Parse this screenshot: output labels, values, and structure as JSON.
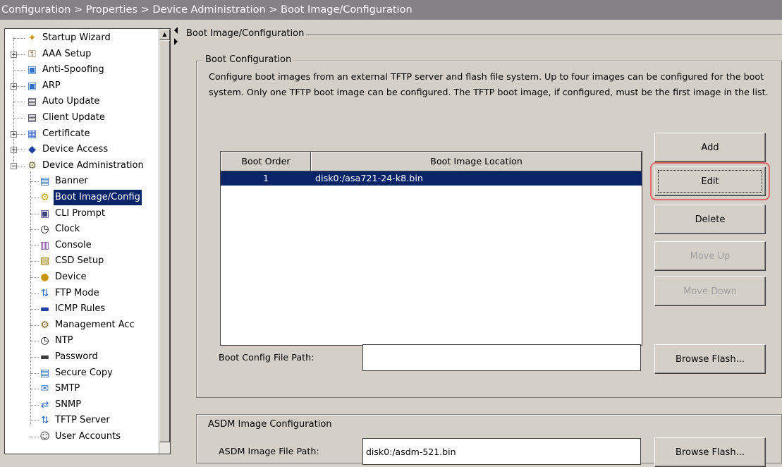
{
  "breadcrumb": "Configuration > Properties > Device Administration > Boot Image/Configuration",
  "tree": [
    {
      "label": "Startup Wizard",
      "icon": "wand-icon",
      "expandable": false,
      "level": 0
    },
    {
      "label": "AAA Setup",
      "icon": "key-icon",
      "expandable": true,
      "level": 0
    },
    {
      "label": "Anti-Spoofing",
      "icon": "shield-window-icon",
      "expandable": false,
      "level": 0
    },
    {
      "label": "ARP",
      "icon": "network-window-icon",
      "expandable": true,
      "level": 0
    },
    {
      "label": "Auto Update",
      "icon": "computer-icon",
      "expandable": false,
      "level": 0
    },
    {
      "label": "Client Update",
      "icon": "computer-icon",
      "expandable": false,
      "level": 0
    },
    {
      "label": "Certificate",
      "icon": "certificate-icon",
      "expandable": true,
      "level": 0
    },
    {
      "label": "Device Access",
      "icon": "device-access-icon",
      "expandable": true,
      "level": 0
    },
    {
      "label": "Device Administration",
      "icon": "admin-icon",
      "expandable": true,
      "expanded": true,
      "level": 0
    },
    {
      "label": "Banner",
      "icon": "banner-icon",
      "level": 1
    },
    {
      "label": "Boot Image/Config",
      "icon": "boot-image-icon",
      "level": 1,
      "selected": true
    },
    {
      "label": "CLI Prompt",
      "icon": "cli-prompt-icon",
      "level": 1
    },
    {
      "label": "Clock",
      "icon": "clock-icon",
      "level": 1
    },
    {
      "label": "Console",
      "icon": "console-icon",
      "level": 1
    },
    {
      "label": "CSD Setup",
      "icon": "csd-setup-icon",
      "level": 1
    },
    {
      "label": "Device",
      "icon": "device-icon",
      "level": 1
    },
    {
      "label": "FTP Mode",
      "icon": "ftp-icon",
      "level": 1
    },
    {
      "label": "ICMP Rules",
      "icon": "icmp-icon",
      "level": 1
    },
    {
      "label": "Management Acc",
      "icon": "management-icon",
      "level": 1
    },
    {
      "label": "NTP",
      "icon": "ntp-clock-icon",
      "level": 1
    },
    {
      "label": "Password",
      "icon": "password-icon",
      "level": 1
    },
    {
      "label": "Secure Copy",
      "icon": "secure-copy-icon",
      "level": 1
    },
    {
      "label": "SMTP",
      "icon": "smtp-icon",
      "level": 1
    },
    {
      "label": "SNMP",
      "icon": "snmp-icon",
      "level": 1
    },
    {
      "label": "TFTP Server",
      "icon": "tftp-icon",
      "level": 1
    },
    {
      "label": "User Accounts",
      "icon": "user-accounts-icon",
      "level": 1
    }
  ],
  "main": {
    "heading": "Boot Image/Configuration",
    "boot_config": {
      "legend": "Boot Configuration",
      "description": "Configure boot images from an external TFTP server and flash file system. Up to four images can be configured for the boot system. Only one TFTP boot image can be configured. The TFTP boot image, if configured, must be the first image in the list.",
      "columns": [
        "Boot Order",
        "Boot Image Location"
      ],
      "rows": [
        {
          "order": "1",
          "location": "disk0:/asa721-24-k8.bin",
          "selected": true
        }
      ],
      "buttons": {
        "add": "Add",
        "edit": "Edit",
        "delete": "Delete",
        "move_up": "Move Up",
        "move_down": "Move Down"
      },
      "config_path_label": "Boot Config File Path:",
      "config_path_value": "",
      "browse_flash": "Browse Flash..."
    },
    "asdm": {
      "legend": "ASDM Image Configuration",
      "path_label": "ASDM Image File Path:",
      "path_value": "disk0:/asdm-521.bin",
      "browse_flash": "Browse Flash..."
    }
  },
  "colors": {
    "selection": "#0a246a",
    "background": "#d4d0c8",
    "highlight_ring": "#e06a6a",
    "titlebar": "#848284"
  }
}
